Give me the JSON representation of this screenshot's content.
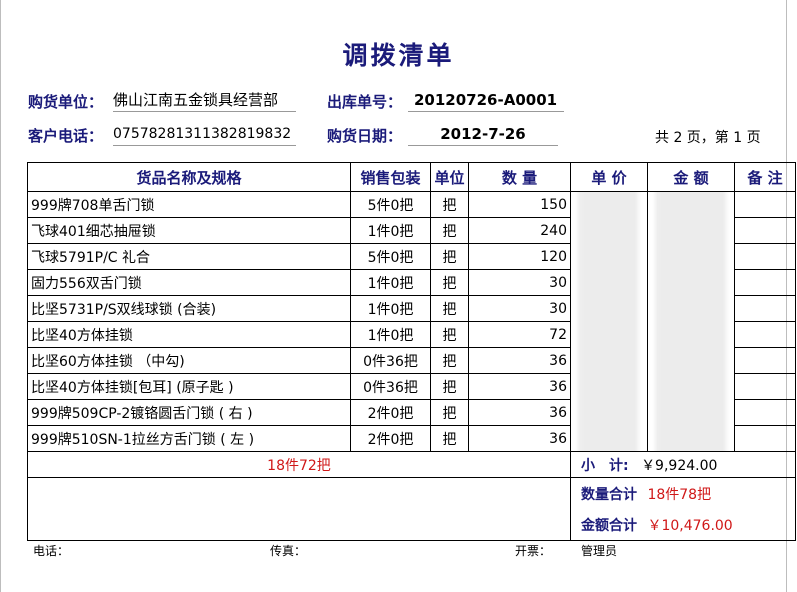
{
  "title": "调拨清单",
  "header": {
    "buyer_label": "购货单位：",
    "buyer_value": "佛山江南五金锁具经营部",
    "order_label": "出库单号：",
    "order_value": "20120726-A0001",
    "phone_label": "客户电话：",
    "phone_value": "07578281311382819832",
    "date_label": "购货日期：",
    "date_value": "2012-7-26",
    "page_info": "共 2 页，第 1 页"
  },
  "table": {
    "columns": [
      "货品名称及规格",
      "销售包装",
      "单位",
      "数 量",
      "单 价",
      "金 额",
      "备 注"
    ],
    "rows": [
      {
        "name": "999牌708单舌门锁",
        "package": "5件0把",
        "unit": "把",
        "qty": "150"
      },
      {
        "name": "飞球401细芯抽屉锁",
        "package": "1件0把",
        "unit": "把",
        "qty": "240"
      },
      {
        "name": "飞球5791P/C 礼合",
        "package": "5件0把",
        "unit": "把",
        "qty": "120"
      },
      {
        "name": "固力556双舌门锁",
        "package": "1件0把",
        "unit": "把",
        "qty": "30"
      },
      {
        "name": "比坚5731P/S双线球锁 (合装)",
        "package": "1件0把",
        "unit": "把",
        "qty": "30"
      },
      {
        "name": "比坚40方体挂锁",
        "package": "1件0把",
        "unit": "把",
        "qty": "72"
      },
      {
        "name": "比坚60方体挂锁 （中勾)",
        "package": "0件36把",
        "unit": "把",
        "qty": "36"
      },
      {
        "name": "比坚40方体挂锁[包耳] (原子匙 )",
        "package": "0件36把",
        "unit": "把",
        "qty": "36"
      },
      {
        "name": "999牌509CP-2镀铬圆舌门锁 ( 右 )",
        "package": "2件0把",
        "unit": "把",
        "qty": "36"
      },
      {
        "name": "999牌510SN-1拉丝方舌门锁 ( 左 )",
        "package": "2件0把",
        "unit": "把",
        "qty": "36"
      }
    ],
    "subtotal_package": "18件72把",
    "subtotal_label": "小　计:",
    "subtotal_amount": "￥9,924.00",
    "total_qty_label": "数量合计",
    "total_qty_value": "18件78把",
    "total_amount_label": "金额合计",
    "total_amount_value": "￥10,476.00"
  },
  "footer": {
    "phone": "电话：",
    "fax": "传真：",
    "invoice": "开票：",
    "operator": "管理员"
  },
  "colors": {
    "heading": "#1b1b7a",
    "highlight": "#d01818"
  }
}
